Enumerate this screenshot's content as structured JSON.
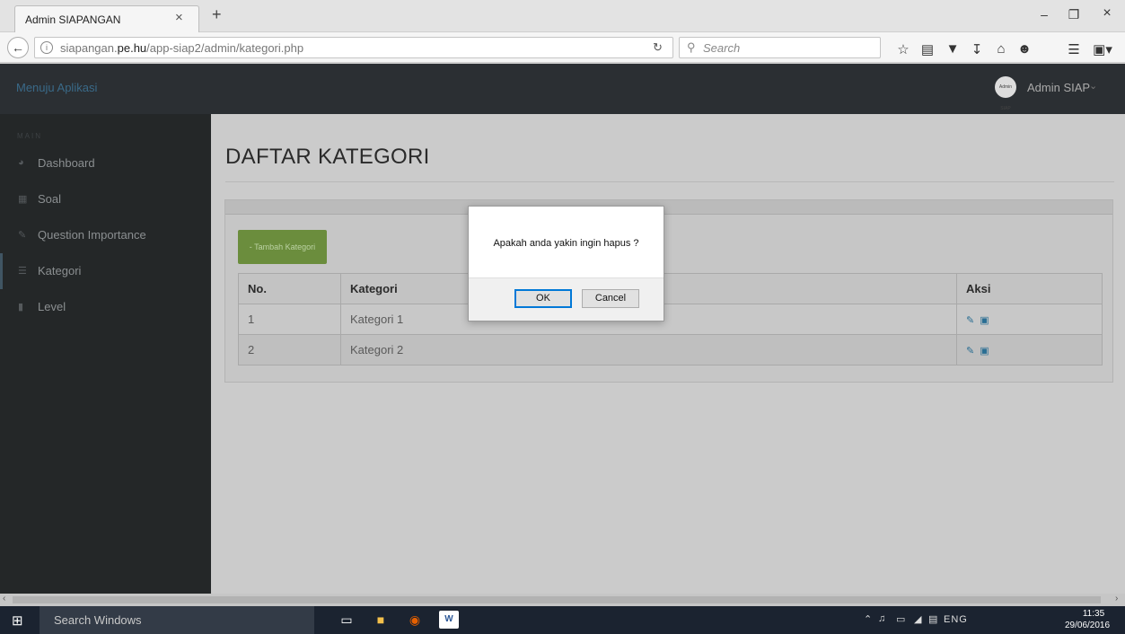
{
  "browser": {
    "tab_title": "Admin SIAPANGAN",
    "tab_close": "×",
    "new_tab": "+",
    "url_prefix": "siapangan.",
    "url_domain": "pe.hu",
    "url_path": "/app-siap2/admin/kategori.php",
    "search_placeholder": "Search",
    "window_minimize": "–",
    "window_maximize": "❐",
    "window_close": "×"
  },
  "topbar": {
    "brand": "Menuju Aplikasi",
    "avatar_text": "Admin SIAP",
    "user_name": "Admin SIAP"
  },
  "sidebar": {
    "section_label": "MAIN",
    "items": [
      {
        "label": "Dashboard",
        "icon": "dashboard-icon"
      },
      {
        "label": "Soal",
        "icon": "table-icon"
      },
      {
        "label": "Question Importance",
        "icon": "edit-icon"
      },
      {
        "label": "Kategori",
        "icon": "sitemap-icon"
      },
      {
        "label": "Level",
        "icon": "bar-chart-icon"
      }
    ]
  },
  "main": {
    "page_title": "DAFTAR KATEGORI",
    "add_button": "- Tambah Kategori",
    "table": {
      "columns": [
        "No.",
        "Kategori",
        "Aksi"
      ],
      "rows": [
        {
          "no": "1",
          "kategori": "Kategori 1"
        },
        {
          "no": "2",
          "kategori": "Kategori 2"
        }
      ]
    }
  },
  "dialog": {
    "message": "Apakah anda yakin ingin hapus ?",
    "ok": "OK",
    "cancel": "Cancel"
  },
  "taskbar": {
    "search": "Search Windows",
    "language": "ENG",
    "time": "11:35",
    "date": "29/06/2016"
  },
  "colors": {
    "topbar": "#2b2f33",
    "sidebar": "#242728",
    "add_button": "#6b8d3d",
    "action_icons": "#2a6e93"
  }
}
